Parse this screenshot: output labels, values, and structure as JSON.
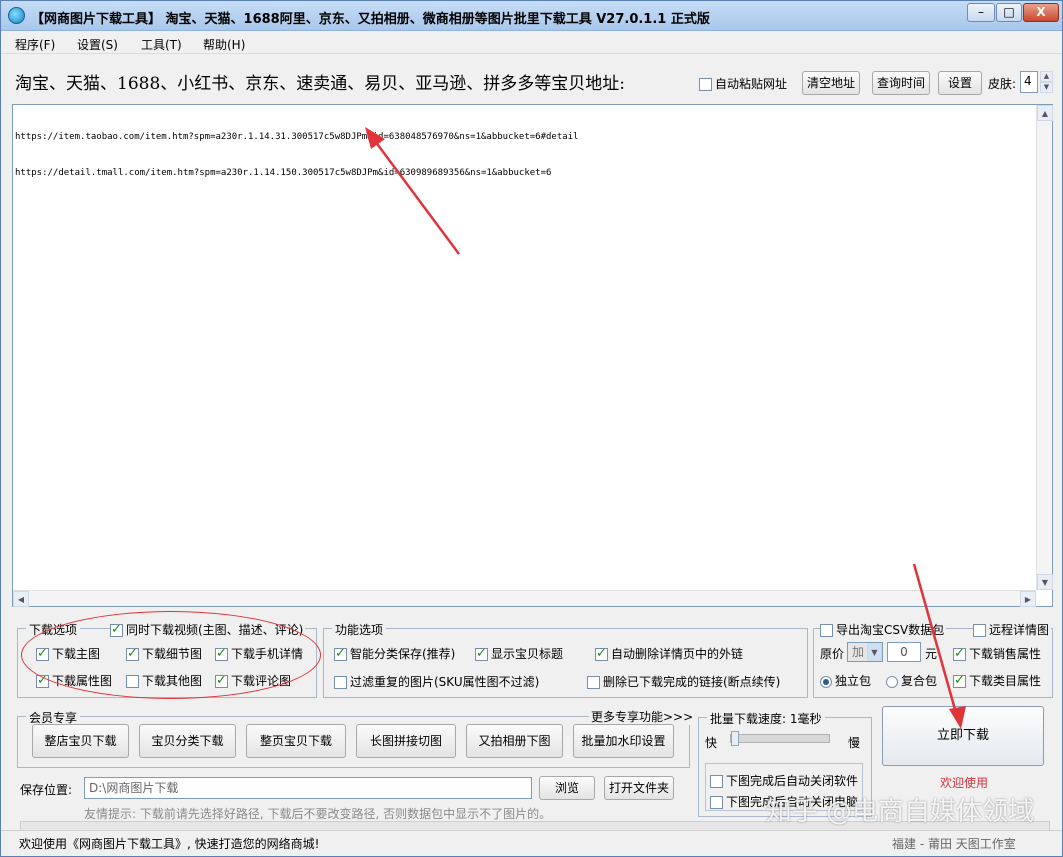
{
  "window": {
    "title": "【网商图片下载工具】 淘宝、天猫、1688阿里、京东、又拍相册、微商相册等图片批里下载工具 V27.0.1.1 正式版",
    "minimize": "–",
    "maximize": "□",
    "close": "X"
  },
  "menu": [
    "程序(F)",
    "设置(S)",
    "工具(T)",
    "帮助(H)"
  ],
  "urlbar": {
    "title": "淘宝、天猫、1688、小红书、京东、速卖通、易贝、亚马逊、拼多多等宝贝地址:",
    "auto_paste": "自动粘贴网址",
    "clear_btn": "清空地址",
    "query_btn": "查询时间",
    "settings_btn": "设置",
    "skin_label": "皮肤:",
    "skin_value": "4"
  },
  "urls": [
    "https://item.taobao.com/item.htm?spm=a230r.1.14.31.300517c5w8DJPm&id=638048576970&ns=1&abbucket=6#detail",
    "https://detail.tmall.com/item.htm?spm=a230r.1.14.150.300517c5w8DJPm&id=630989689356&ns=1&abbucket=6"
  ],
  "download_options": {
    "title": "下载选项",
    "video": "同时下载视频(主图、描述、评论)",
    "items": [
      {
        "label": "下载主图",
        "checked": true
      },
      {
        "label": "下载细节图",
        "checked": true
      },
      {
        "label": "下载手机详情",
        "checked": true
      },
      {
        "label": "下载属性图",
        "checked": true
      },
      {
        "label": "下载其他图",
        "checked": false
      },
      {
        "label": "下载评论图",
        "checked": true
      }
    ]
  },
  "function_options": {
    "title": "功能选项",
    "items": [
      {
        "label": "智能分类保存(推荐)",
        "checked": true
      },
      {
        "label": "显示宝贝标题",
        "checked": true
      },
      {
        "label": "自动删除详情页中的外链",
        "checked": true
      },
      {
        "label": "过滤重复的图片(SKU属性图不过滤)",
        "checked": false
      },
      {
        "label": "删除已下载完成的链接(断点续传)",
        "checked": false
      }
    ]
  },
  "csv": {
    "title": "导出淘宝CSV数据包",
    "remote": "远程详情图",
    "price_label": "原价",
    "price_op": "加",
    "price_value": "0",
    "unit": "元",
    "sales_attr": "下载销售属性",
    "category_attr": "下载类目属性",
    "single_pkg": "独立包",
    "combo_pkg": "复合包"
  },
  "member": {
    "title": "会员专享",
    "more": "更多专享功能>>>",
    "buttons": [
      "整店宝贝下载",
      "宝贝分类下载",
      "整页宝贝下载",
      "长图拼接切图",
      "又拍相册下图",
      "批量加水印设置"
    ]
  },
  "speed": {
    "title": "批量下载速度: 1毫秒",
    "fast": "快",
    "slow": "慢",
    "level": 0,
    "close_app": "下图完成后自动关闭软件",
    "shutdown": "下图完成后自动关闭电脑"
  },
  "download_btn": "立即下载",
  "welcome": "欢迎使用",
  "save": {
    "label": "保存位置:",
    "path": "D:\\网商图片下载",
    "browse": "浏览",
    "open": "打开文件夹",
    "tip": "友情提示: 下载前请先选择好路径, 下载后不要改变路径, 否则数据包中显示不了图片的。"
  },
  "status": {
    "left": "欢迎使用《网商图片下载工具》, 快速打造您的网络商城!",
    "right": "福建 - 莆田 天图工作室"
  },
  "watermark": "知乎 @电商自媒体领域",
  "colors": {
    "annotation": "#e0333a",
    "title_bar": "#b8d3f0",
    "welcome": "#d4343a"
  }
}
